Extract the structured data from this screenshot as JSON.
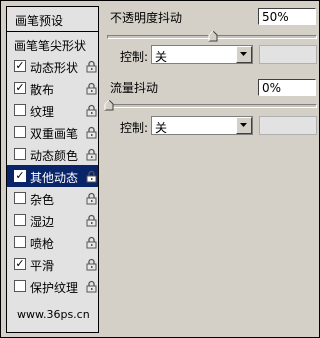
{
  "list": {
    "header": "画笔预设",
    "tip_shape": "画笔笔尖形状",
    "items": [
      {
        "label": "动态形状",
        "checked": true,
        "mark": "✓"
      },
      {
        "label": "散布",
        "checked": true,
        "mark": "✓"
      },
      {
        "label": "纹理",
        "checked": false,
        "mark": ""
      },
      {
        "label": "双重画笔",
        "checked": false,
        "mark": ""
      },
      {
        "label": "动态颜色",
        "checked": false,
        "mark": ""
      },
      {
        "label": "其他动态",
        "checked": true,
        "mark": "✓",
        "selected": true
      },
      {
        "label": "杂色",
        "checked": false,
        "mark": ""
      },
      {
        "label": "湿边",
        "checked": false,
        "mark": ""
      },
      {
        "label": "喷枪",
        "checked": false,
        "mark": ""
      },
      {
        "label": "平滑",
        "checked": true,
        "mark": "✓"
      },
      {
        "label": "保护纹理",
        "checked": false,
        "mark": ""
      }
    ],
    "watermark": "www.36ps.cn"
  },
  "opacity": {
    "label": "不透明度抖动",
    "value": "50%",
    "slider_fraction": 0.5,
    "control_label": "控制:",
    "control_value": "关"
  },
  "flow": {
    "label": "流量抖动",
    "value": "0%",
    "slider_fraction": 0.0,
    "control_label": "控制:",
    "control_value": "关"
  },
  "colors": {
    "panel_bg": "#d4d0c8",
    "list_bg": "#e2e2e2",
    "selected_bg": "#0a246a"
  }
}
